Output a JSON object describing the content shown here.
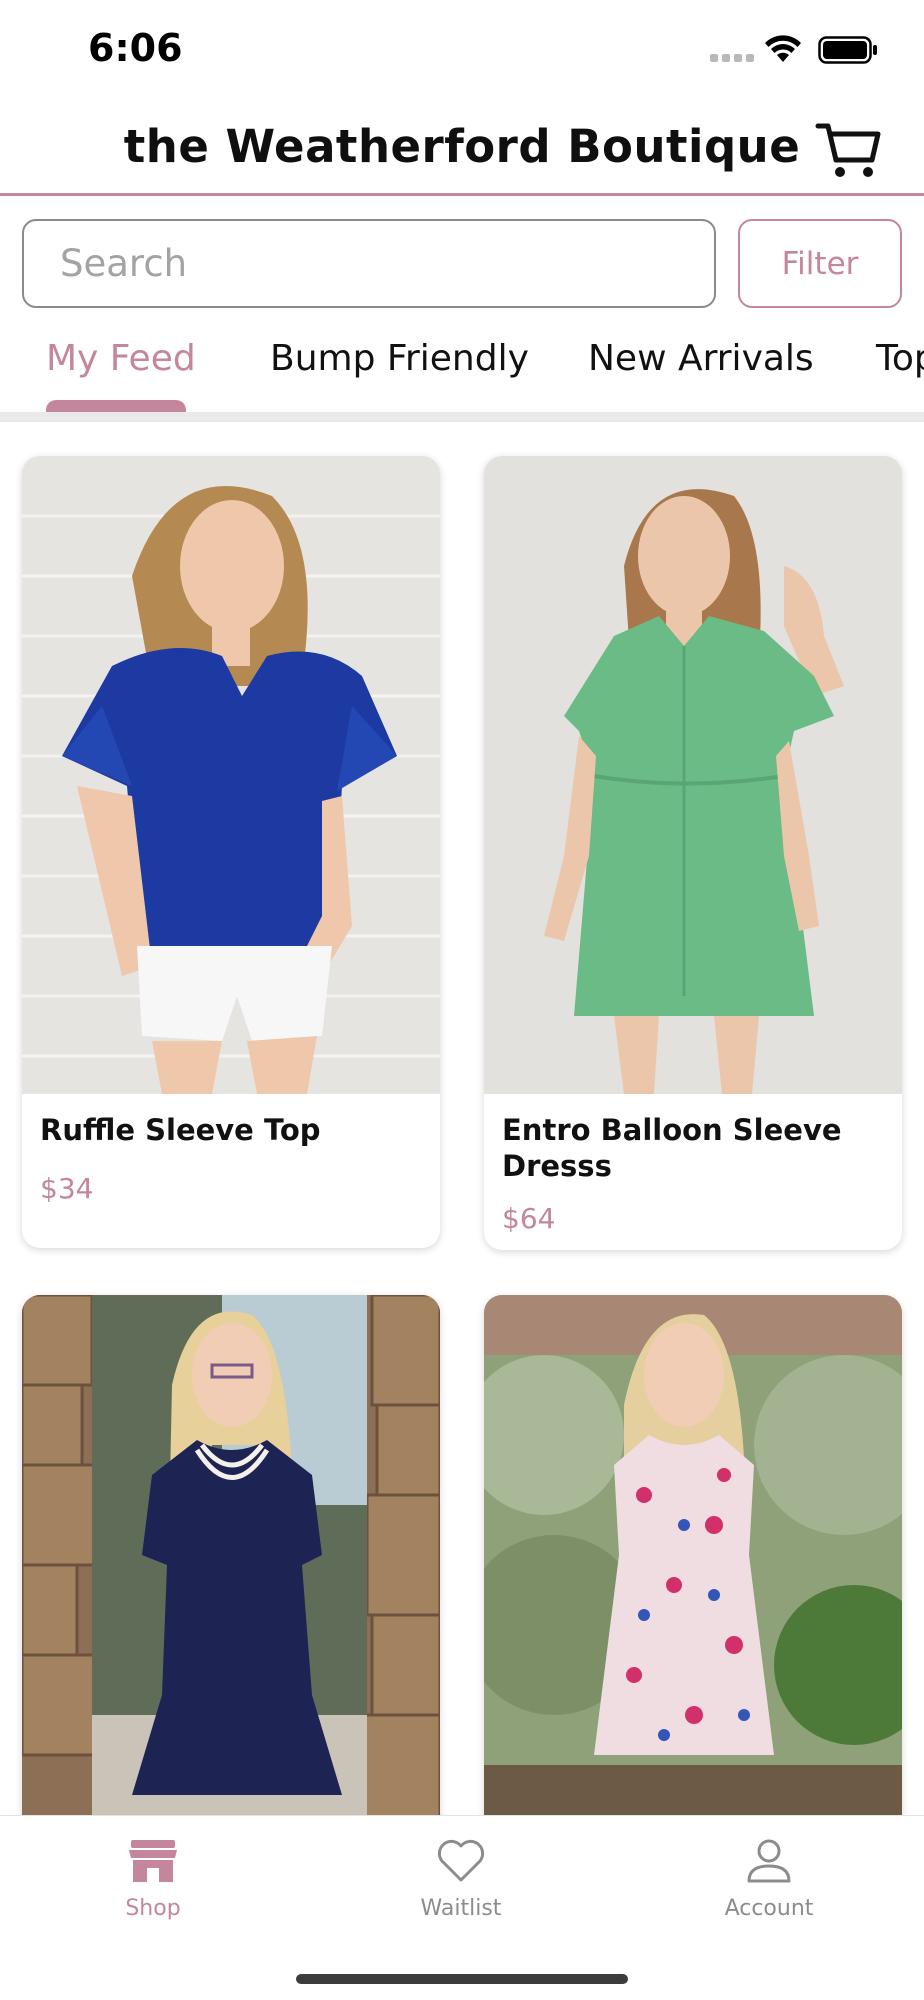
{
  "status_bar": {
    "time": "6:06"
  },
  "header": {
    "title": "the Weatherford Boutique"
  },
  "search": {
    "placeholder": "Search",
    "filter_label": "Filter"
  },
  "tabs": [
    {
      "label": "My Feed",
      "active": true
    },
    {
      "label": "Bump Friendly",
      "active": false
    },
    {
      "label": "New Arrivals",
      "active": false
    },
    {
      "label": "Tops",
      "active": false
    }
  ],
  "products": [
    {
      "name": "Ruffle Sleeve Top",
      "price": "$34",
      "image": "woman-in-royal-blue-ruffle-sleeve-top"
    },
    {
      "name": "Entro Balloon Sleeve Dresss",
      "price": "$64",
      "image": "woman-in-green-button-front-dress"
    },
    {
      "name": "",
      "price": "",
      "image": "woman-in-navy-swiss-dot-dress"
    },
    {
      "name": "",
      "price": "",
      "image": "woman-in-floral-sleeveless-dress"
    }
  ],
  "bottom_nav": [
    {
      "label": "Shop",
      "icon": "storefront-icon",
      "active": true
    },
    {
      "label": "Waitlist",
      "icon": "heart-icon",
      "active": false
    },
    {
      "label": "Account",
      "icon": "person-icon",
      "active": false
    }
  ],
  "colors": {
    "accent": "#c4869d",
    "inactive": "#8c8c8c",
    "divider": "#e9e9e9"
  }
}
